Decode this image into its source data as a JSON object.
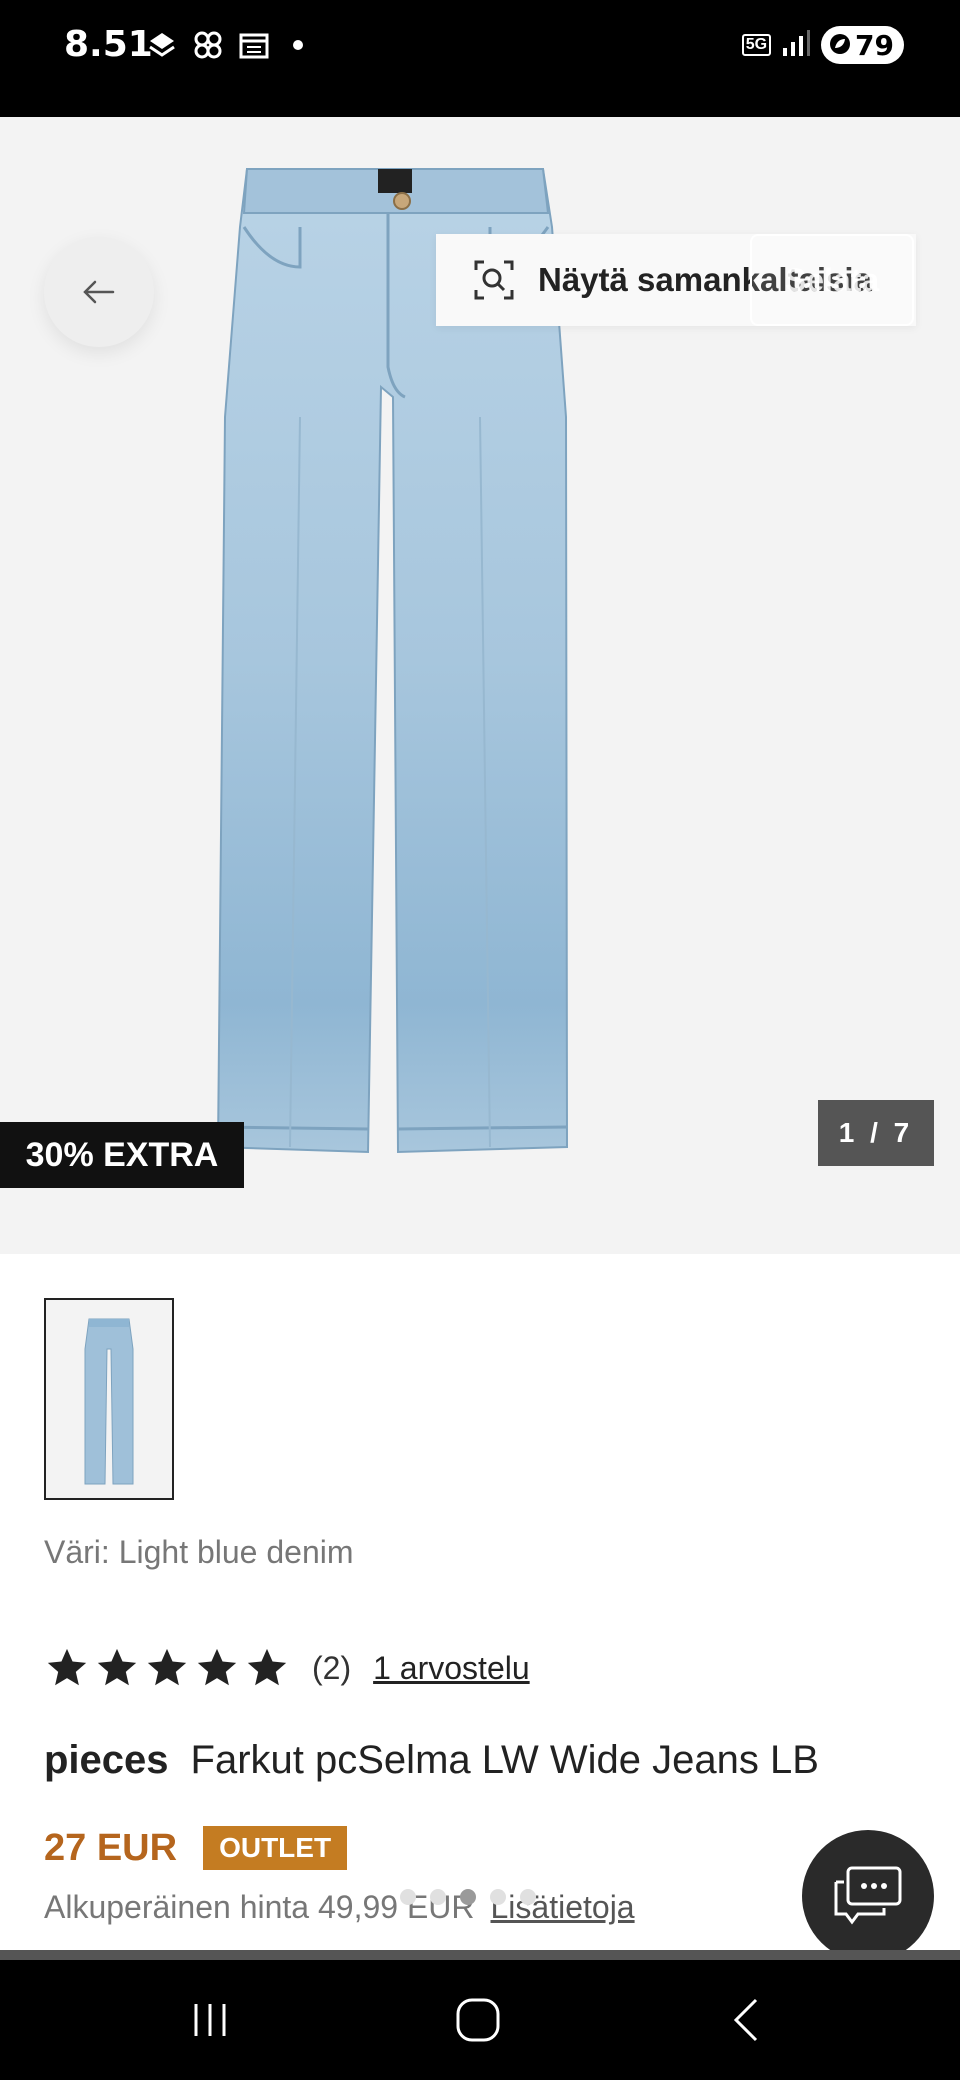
{
  "status_bar": {
    "time": "8.51",
    "network": "5G",
    "battery": "79"
  },
  "hero": {
    "find_similar_label": "Näytä samankaltaisia",
    "search_overlay_label": "Selata",
    "extra_badge": "30% EXTRA",
    "image_counter": "1 / 7"
  },
  "product": {
    "color_line": "Väri: Light blue denim",
    "rating": 5,
    "rating_count": "(2)",
    "reviews_link": "1 arvostelu",
    "brand": "pieces",
    "name": "Farkut pcSelma LW Wide Jeans LB",
    "price": "27 EUR",
    "outlet_badge": "OUTLET",
    "original_price": "Alkuperäinen hinta 49,99 EUR",
    "more_info_link": "Lisätietoja"
  },
  "colors": {
    "price": "#b5651d",
    "outlet_badge": "#c47c22",
    "denim": "#a9c7de"
  }
}
